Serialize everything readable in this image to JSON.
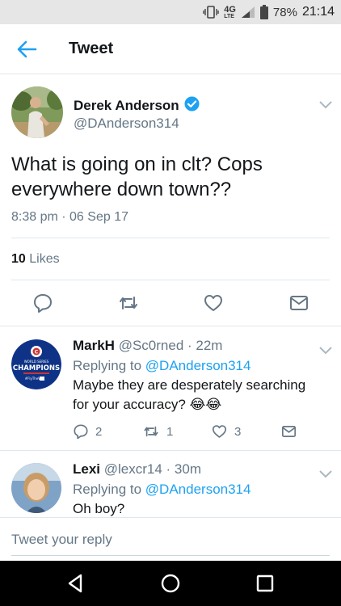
{
  "status_bar": {
    "network": "4G",
    "network_sub": "LTE",
    "battery": "78%",
    "time": "21:14"
  },
  "app_bar": {
    "title": "Tweet"
  },
  "tweet": {
    "author_name": "Derek Anderson",
    "author_handle": "@DAnderson314",
    "text": "What is going on in clt? Cops everywhere down town??",
    "timestamp": "8:38 pm · 06 Sep 17",
    "likes_count": "10",
    "likes_label": "Likes"
  },
  "replies": [
    {
      "name": "MarkH",
      "handle_time": "@Sc0rned · 22m",
      "replying_prefix": "Replying to",
      "replying_handle": "@DAnderson314",
      "text": "Maybe they are desperately searching for your accuracy? 😂😂",
      "reply_count": "2",
      "retweet_count": "1",
      "like_count": "3",
      "avatar_caption": "CHAMPIONS"
    },
    {
      "name": "Lexi",
      "handle_time": "@lexcr14 · 30m",
      "replying_prefix": "Replying to",
      "replying_handle": "@DAnderson314",
      "text": "Oh boy?"
    }
  ],
  "compose": {
    "placeholder": "Tweet your reply"
  },
  "colors": {
    "accent": "#1da1f2",
    "secondary_text": "#657786",
    "primary_text": "#14171a",
    "divider": "#e1e8ed"
  }
}
